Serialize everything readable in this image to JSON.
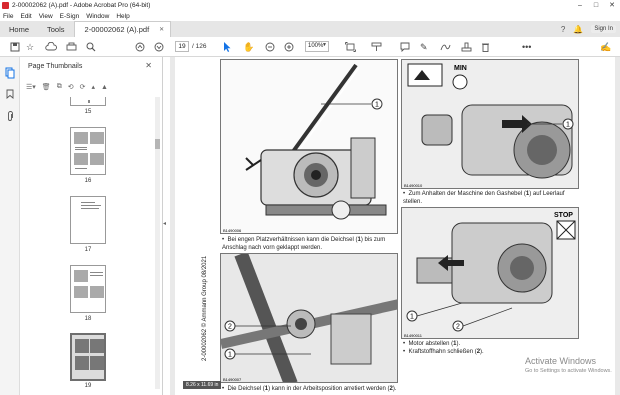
{
  "window": {
    "title": "2-00002062 (A).pdf - Adobe Acrobat Pro (64-bit)",
    "controls": [
      "–",
      "□",
      "✕"
    ]
  },
  "menu": {
    "items": [
      "File",
      "Edit",
      "View",
      "E-Sign",
      "Window",
      "Help"
    ]
  },
  "tabs": {
    "home": "Home",
    "tools": "Tools",
    "document": "2-00002062 (A).pdf",
    "close": "✕",
    "help": "?",
    "signin": "Sign In"
  },
  "toolbar": {
    "page_current": "19",
    "page_total": "/ 126",
    "zoom": "100%"
  },
  "thumbnails": {
    "header": "Page Thumbnails",
    "close": "✕",
    "pages": [
      {
        "label": "15"
      },
      {
        "label": "16"
      },
      {
        "label": "17"
      },
      {
        "label": "18"
      },
      {
        "label": "19"
      }
    ],
    "active_index": 4
  },
  "document": {
    "vertical_text": "2-00002062 © Ammann Group 08/2021",
    "captions": {
      "c1_a": "Bei engen Platzverhältnissen kann die Deichsel (",
      "c1_num": "1",
      "c1_b": ") bis zum Anschlag nach vorn geklappt werden.",
      "c2_a": "Zum Anhalten der Maschine den Gashebel (",
      "c2_num": "1",
      "c2_b": ") auf Leerlauf stellen.",
      "c3_a": "Motor abstellen (",
      "c3_num": "1",
      "c3_b": ").",
      "c4_a": "Kraftstoffhahn schließen (",
      "c4_num": "2",
      "c4_b": ").",
      "c5_a": "Die Deichsel (",
      "c5_num": "1",
      "c5_b": ") kann in der Arbeitsposition arretiert werden (",
      "c5_num2": "2",
      "c5_c": ")."
    },
    "image_codes": {
      "img1": "B1490006",
      "img2": "B1490007",
      "img3": "B1490010",
      "img4": "B1490011"
    },
    "callouts": {
      "one": "1",
      "two": "2"
    },
    "labels": {
      "min": "MIN",
      "stop": "STOP"
    },
    "dims": "8.26 x 11.69 in"
  },
  "watermark": {
    "line1": "Activate Windows",
    "line2": "Go to Settings to activate Windows."
  }
}
